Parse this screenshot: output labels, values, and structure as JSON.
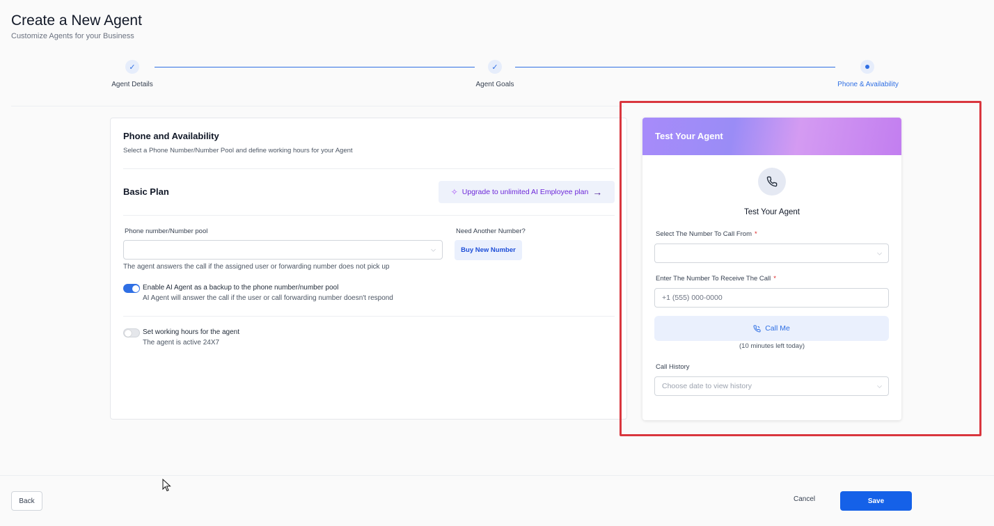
{
  "header": {
    "title": "Create a New Agent",
    "subtitle": "Customize Agents for your Business"
  },
  "stepper": {
    "steps": [
      {
        "label": "Agent Details",
        "status": "completed"
      },
      {
        "label": "Agent Goals",
        "status": "completed"
      },
      {
        "label": "Phone & Availability",
        "status": "active"
      }
    ],
    "check_glyph": "✓"
  },
  "main": {
    "section_title": "Phone and Availability",
    "section_desc": "Select a Phone Number/Number Pool and define working hours for your Agent",
    "plan_title": "Basic Plan",
    "upgrade_label": "Upgrade to unlimited AI Employee plan",
    "phone_label": "Phone number/Number pool",
    "phone_value": "",
    "need_number_label": "Need Another Number?",
    "buy_label": "Buy New Number",
    "help_text": "The agent answers the call if the assigned user or forwarding number does not pick up",
    "backup_toggle": {
      "title": "Enable AI Agent as a backup to the phone number/number pool",
      "subtitle": "AI Agent will answer the call if the user or call forwarding number doesn't respond",
      "on": true
    },
    "hours_toggle": {
      "title": "Set working hours for the agent",
      "subtitle": "The agent is active 24X7",
      "on": false
    }
  },
  "test_panel": {
    "header": "Test Your Agent",
    "title": "Test Your Agent",
    "call_from_label": "Select The Number To Call From",
    "call_from_value": "",
    "receive_label": "Enter The Number To Receive The Call",
    "receive_placeholder": "+1 (555) 000-0000",
    "required_mark": "*",
    "call_button": "Call Me",
    "minutes_left": "(10 minutes left today)",
    "history_label": "Call History",
    "history_placeholder": "Choose date to view history"
  },
  "footer": {
    "back": "Back",
    "cancel": "Cancel",
    "save": "Save"
  },
  "colors": {
    "primary": "#1561e8",
    "accent_purple": "#6d28d9",
    "highlight_red": "#d9363e"
  },
  "icons": [
    "check-icon",
    "sparkle-icon",
    "arrow-right-icon",
    "chevron-down-icon",
    "phone-icon",
    "phone-call-icon",
    "mouse-cursor-icon"
  ]
}
